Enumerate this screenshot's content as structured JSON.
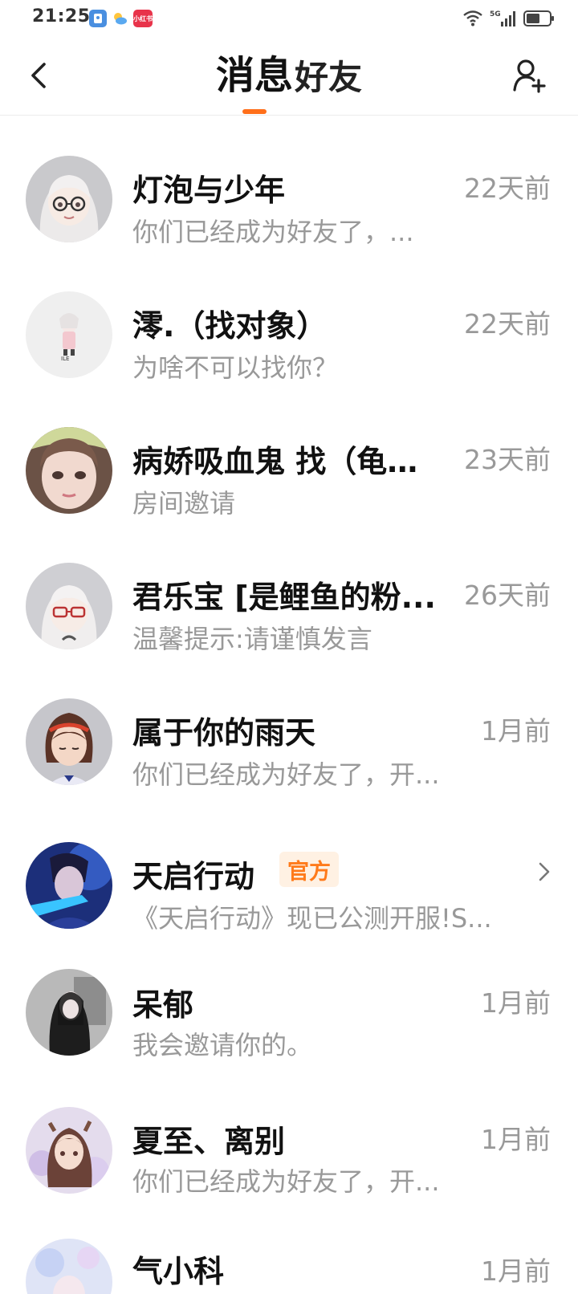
{
  "status_bar": {
    "time": "21:25",
    "apps": [
      "contacts-app-icon",
      "weather-app-icon",
      "xiaohongshu-app-icon"
    ],
    "app_c_text": "小红书",
    "network": "5G"
  },
  "nav": {
    "tabs": [
      {
        "label": "消息",
        "active": true
      },
      {
        "label": "好友",
        "active": false
      }
    ]
  },
  "accent_color": "#ff6f1a",
  "conversations": [
    {
      "name": "灯泡与少年",
      "time": "22天前",
      "preview": "你们已经成为好友了，..."
    },
    {
      "name": "澪.（找对象）",
      "time": "22天前",
      "preview": "为啥不可以找你？"
    },
    {
      "name": "病娇吸血鬼 找（龟）...",
      "time": "23天前",
      "preview": "房间邀请"
    },
    {
      "name": "君乐宝 [是鲤鱼的粉...",
      "time": "26天前",
      "preview": "温馨提示:请谨慎发言"
    },
    {
      "name": "属于你的雨天",
      "time": "1月前",
      "preview": "你们已经成为好友了，开..."
    },
    {
      "name": "天启行动",
      "badge": "官方",
      "time": "",
      "preview": "《天启行动》现已公测开服!S..."
    },
    {
      "name": "呆郁",
      "time": "1月前",
      "preview": "我会邀请你的。"
    },
    {
      "name": "夏至、离别",
      "time": "1月前",
      "preview": "你们已经成为好友了，开..."
    },
    {
      "name": "气小科",
      "time": "1月前",
      "preview": ""
    }
  ]
}
